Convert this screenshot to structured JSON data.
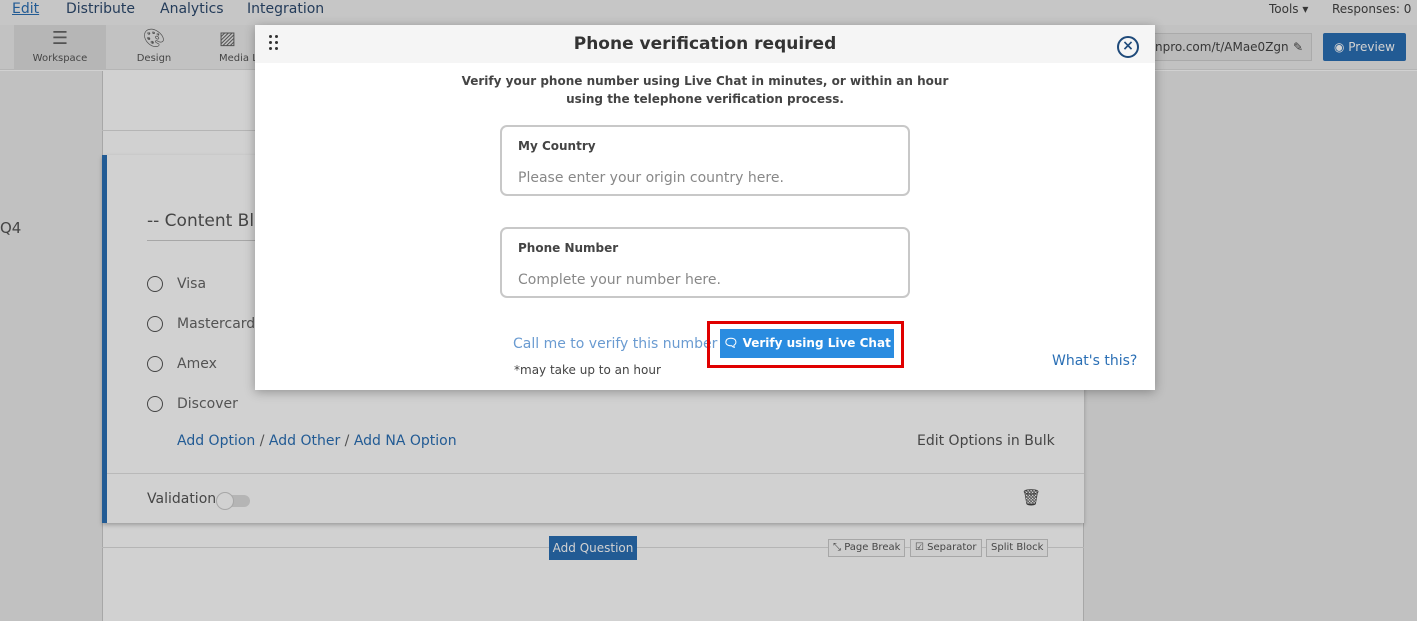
{
  "topnav": {
    "tabs": [
      {
        "label": "Edit",
        "active": true
      },
      {
        "label": "Distribute",
        "active": false
      },
      {
        "label": "Analytics",
        "active": false
      },
      {
        "label": "Integration",
        "active": false
      }
    ],
    "tools_label": "Tools ▾",
    "responses_label": "Responses: 0"
  },
  "toolbar": {
    "items": [
      {
        "label": "Workspace",
        "icon": "workspace-icon"
      },
      {
        "label": "Design",
        "icon": "palette-icon"
      },
      {
        "label": "Media L",
        "icon": "image-icon"
      }
    ],
    "url_text": "npro.com/t/AMae0Zgn",
    "preview_label": "Preview"
  },
  "survey": {
    "question_number": "Q4",
    "content_block_title": "-- Content Blo",
    "options": [
      "Visa",
      "Mastercard",
      "Amex",
      "Discover"
    ],
    "add_option": "Add Option",
    "add_other": "Add Other",
    "add_na": "Add NA Option",
    "slash": "/",
    "edit_bulk": "Edit Options in Bulk",
    "validation_label": "Validation",
    "add_question": "Add Question",
    "page_break": "Page Break",
    "separator": "Separator",
    "split_block": "Split Block"
  },
  "modal": {
    "title": "Phone verification required",
    "close_symbol": "×",
    "intro_line1": "Verify your phone number using Live Chat in minutes, or within an hour",
    "intro_line2": "using the telephone verification process.",
    "country": {
      "label": "My Country",
      "placeholder": "Please enter your origin country here."
    },
    "phone": {
      "label": "Phone Number",
      "placeholder": "Complete your number here."
    },
    "call_link": "Call me to verify this number",
    "call_note": "*may take up to an hour",
    "live_chat_button": "Verify using Live Chat",
    "whats_this": "What's this?"
  },
  "colors": {
    "brand_blue": "#2a6fb5",
    "button_blue": "#2a8ce0",
    "highlight_red": "#e00000"
  }
}
